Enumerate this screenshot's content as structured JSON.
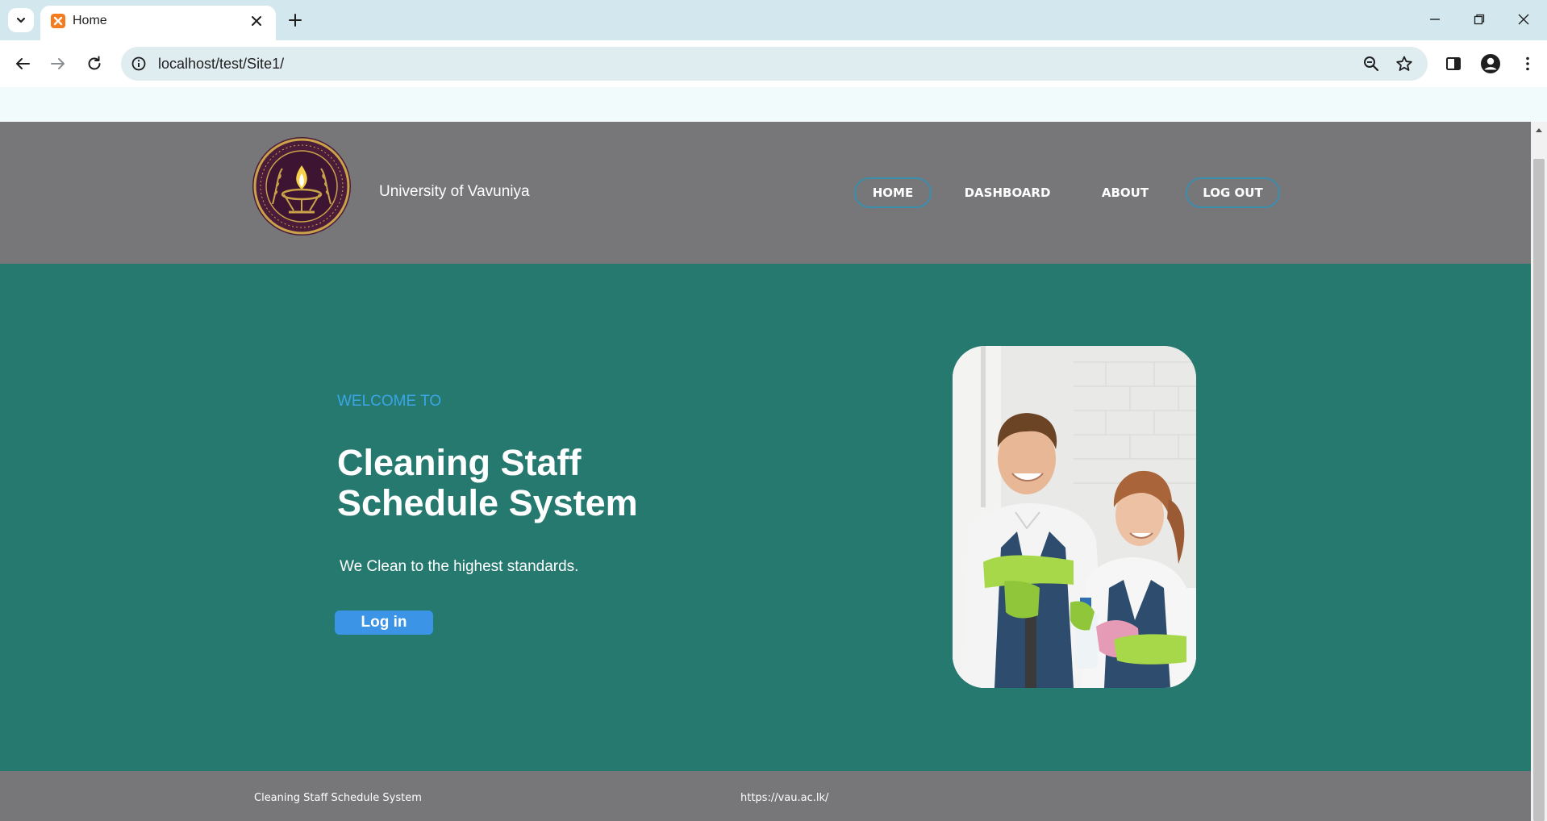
{
  "browser": {
    "tab_title": "Home",
    "url": "localhost/test/Site1/",
    "icons": [
      "chevron-down-icon",
      "xampp-favicon-icon",
      "close-icon",
      "plus-icon",
      "minimize-icon",
      "restore-icon",
      "close-window-icon",
      "back-arrow-icon",
      "forward-arrow-icon",
      "reload-icon",
      "info-icon",
      "zoom-icon",
      "star-icon",
      "side-panel-icon",
      "profile-icon",
      "more-vert-icon"
    ]
  },
  "header": {
    "brand": "University of Vavuniya",
    "nav": {
      "home": "HOME",
      "dashboard": "DASHBOARD",
      "about": "ABOUT",
      "logout": "LOG OUT"
    }
  },
  "hero": {
    "welcome": "WELCOME TO",
    "title": "Cleaning Staff Schedule System",
    "subtitle": "We Clean to the highest standards.",
    "login_button": "Log in"
  },
  "footer": {
    "left": "Cleaning Staff Schedule System",
    "center": "https://vau.ac.lk/"
  },
  "colors": {
    "header_bg": "#777678",
    "hero_bg": "#26796e",
    "welcome_text": "#3aa6e8",
    "button_bg": "#3b94e6",
    "nav_outline": "#3a8fae",
    "chrome_tabbar": "#d3e8ee"
  }
}
